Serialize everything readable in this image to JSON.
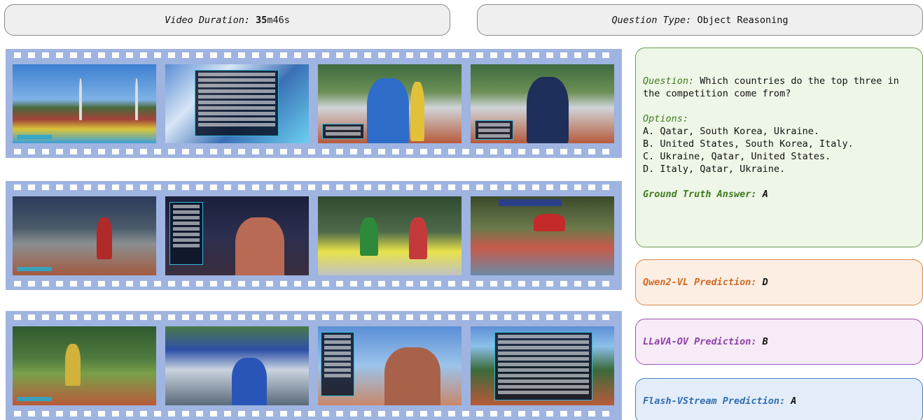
{
  "header": {
    "duration_key": "Video Duration:",
    "duration_bold": "35",
    "duration_rest": "m46s",
    "qtype_key": "Question Type:",
    "qtype_value": "Object Reasoning"
  },
  "question": {
    "label": "Question:",
    "text": "Which countries do the top three in the competition come from?",
    "options_label": "Options:",
    "options": [
      "A. Qatar, South Korea, Ukraine.",
      "B. United States, South Korea, Italy.",
      "C. Ukraine, Qatar, United States.",
      "D. Italy, Qatar, Ukraine."
    ],
    "gt_label": "Ground Truth Answer:",
    "gt_value": "A"
  },
  "predictions": [
    {
      "label": "Qwen2-VL Prediction:",
      "value": "D"
    },
    {
      "label": "LLaVA-OV Prediction:",
      "value": "B"
    },
    {
      "label": "Flash-VStream Prediction:",
      "value": "A"
    }
  ],
  "frames": [
    "high-jump-wide",
    "results-board",
    "athlete-israel",
    "athlete-usa",
    "run-up",
    "celebration",
    "fans-stand",
    "bar-clearance",
    "approach-run",
    "tamberi",
    "barshim-face",
    "final-standings"
  ],
  "colors": {
    "film_strip": "#9fb4e0",
    "question_border": "#6e9a4a",
    "qwen": "#d06a22",
    "llava": "#8e3fa6",
    "flash": "#2f6db3"
  }
}
